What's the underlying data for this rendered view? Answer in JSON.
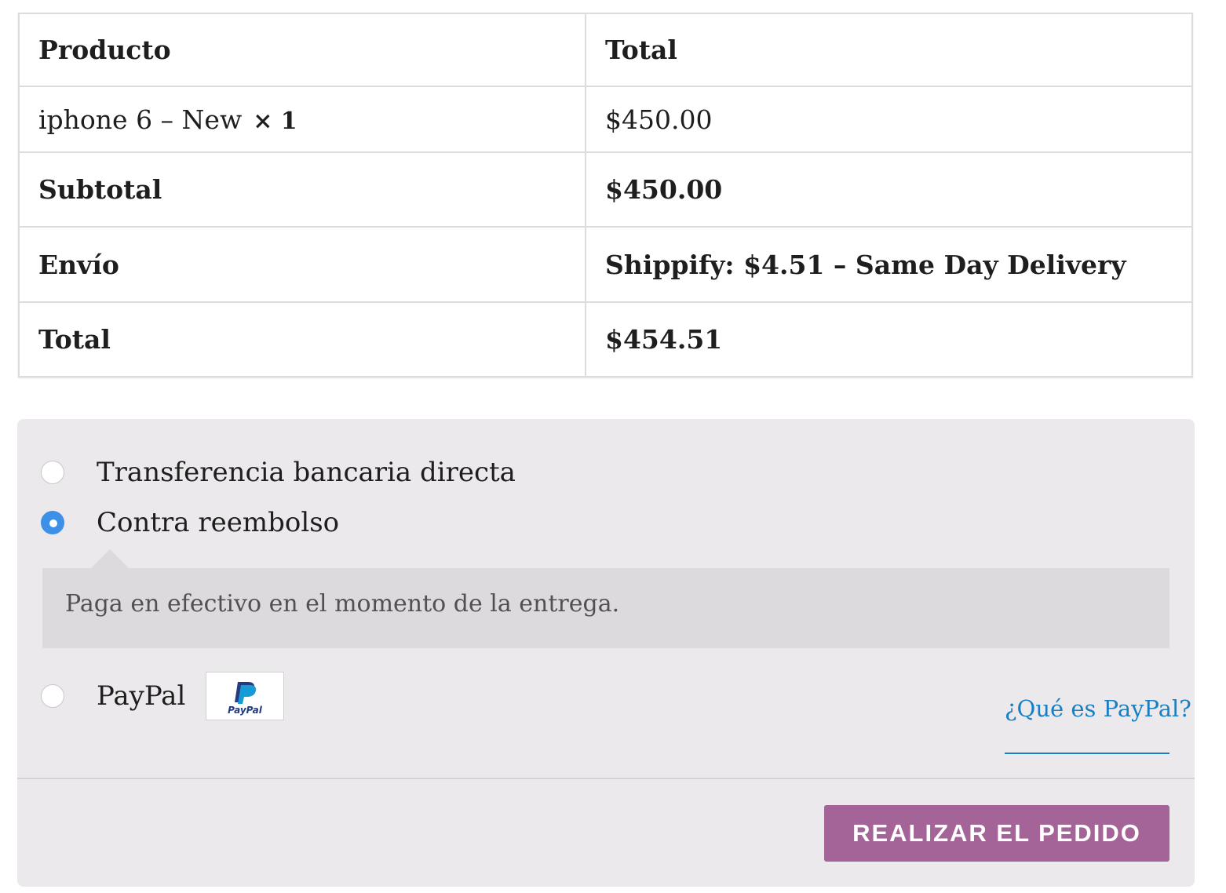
{
  "order_table": {
    "header": {
      "product": "Producto",
      "total": "Total"
    },
    "items": [
      {
        "name": "iphone 6 – New",
        "quantity": "× 1",
        "total": "$450.00"
      }
    ],
    "subtotal": {
      "label": "Subtotal",
      "value": "$450.00"
    },
    "shipping": {
      "label": "Envío",
      "value": "Shippify: $4.51 – Same Day Delivery"
    },
    "total": {
      "label": "Total",
      "value": "$454.51"
    }
  },
  "payment": {
    "methods": [
      {
        "label": "Transferencia bancaria directa",
        "selected": false
      },
      {
        "label": "Contra reembolso",
        "selected": true,
        "description": "Paga en efectivo en el momento de la entrega."
      },
      {
        "label": "PayPal",
        "selected": false,
        "icon": "paypal-logo-icon",
        "link": "¿Qué es PayPal?"
      }
    ],
    "paypal_logo_text": "PayPal"
  },
  "place_order": {
    "label": "REALIZAR EL PEDIDO"
  },
  "colors": {
    "accent_button": "#a46497",
    "link": "#1a7fc1",
    "radio_selected": "#3d8fe8",
    "payment_background": "#ebe9eb",
    "description_background": "#dcdadc"
  }
}
